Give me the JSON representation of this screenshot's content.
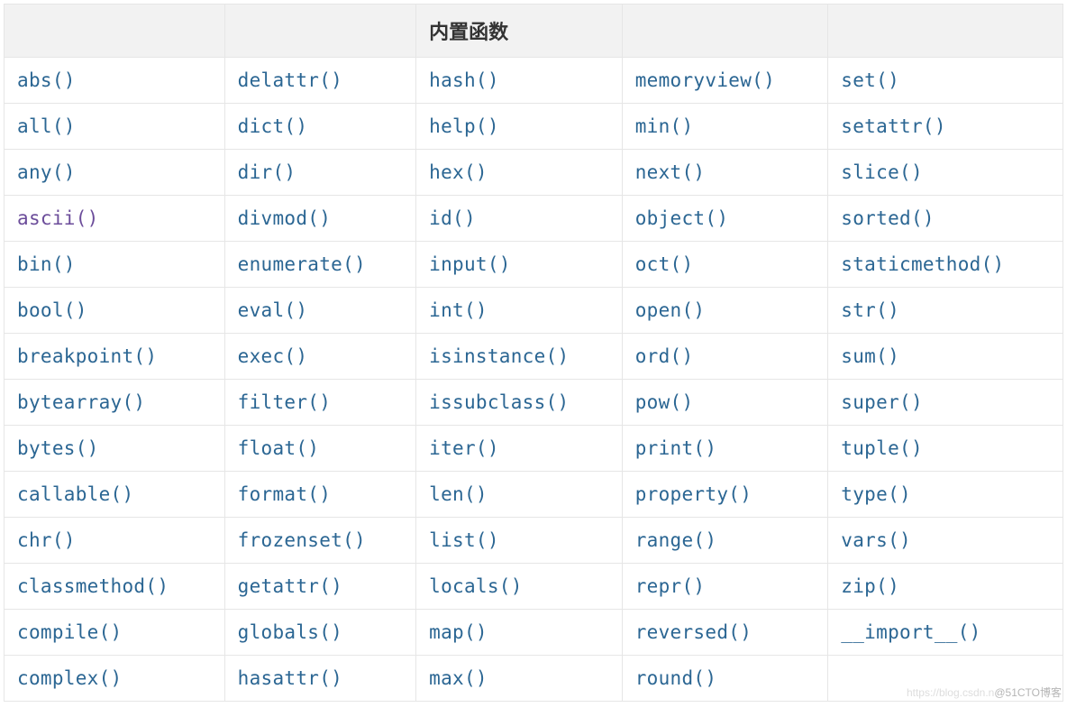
{
  "table": {
    "headers": [
      "",
      "",
      "内置函数",
      "",
      ""
    ],
    "rows": [
      [
        {
          "label": "abs()"
        },
        {
          "label": "delattr()"
        },
        {
          "label": "hash()"
        },
        {
          "label": "memoryview()"
        },
        {
          "label": "set()"
        }
      ],
      [
        {
          "label": "all()"
        },
        {
          "label": "dict()"
        },
        {
          "label": "help()"
        },
        {
          "label": "min()"
        },
        {
          "label": "setattr()"
        }
      ],
      [
        {
          "label": "any()"
        },
        {
          "label": "dir()"
        },
        {
          "label": "hex()"
        },
        {
          "label": "next()"
        },
        {
          "label": "slice()"
        }
      ],
      [
        {
          "label": "ascii()",
          "visited": true
        },
        {
          "label": "divmod()"
        },
        {
          "label": "id()"
        },
        {
          "label": "object()"
        },
        {
          "label": "sorted()"
        }
      ],
      [
        {
          "label": "bin()"
        },
        {
          "label": "enumerate()"
        },
        {
          "label": "input()"
        },
        {
          "label": "oct()"
        },
        {
          "label": "staticmethod()"
        }
      ],
      [
        {
          "label": "bool()"
        },
        {
          "label": "eval()"
        },
        {
          "label": "int()"
        },
        {
          "label": "open()"
        },
        {
          "label": "str()"
        }
      ],
      [
        {
          "label": "breakpoint()"
        },
        {
          "label": "exec()"
        },
        {
          "label": "isinstance()"
        },
        {
          "label": "ord()"
        },
        {
          "label": "sum()"
        }
      ],
      [
        {
          "label": "bytearray()"
        },
        {
          "label": "filter()"
        },
        {
          "label": "issubclass()"
        },
        {
          "label": "pow()"
        },
        {
          "label": "super()"
        }
      ],
      [
        {
          "label": "bytes()"
        },
        {
          "label": "float()"
        },
        {
          "label": "iter()"
        },
        {
          "label": "print()"
        },
        {
          "label": "tuple()"
        }
      ],
      [
        {
          "label": "callable()"
        },
        {
          "label": "format()"
        },
        {
          "label": "len()"
        },
        {
          "label": "property()"
        },
        {
          "label": "type()"
        }
      ],
      [
        {
          "label": "chr()"
        },
        {
          "label": "frozenset()"
        },
        {
          "label": "list()"
        },
        {
          "label": "range()"
        },
        {
          "label": "vars()"
        }
      ],
      [
        {
          "label": "classmethod()"
        },
        {
          "label": "getattr()"
        },
        {
          "label": "locals()"
        },
        {
          "label": "repr()"
        },
        {
          "label": "zip()"
        }
      ],
      [
        {
          "label": "compile()"
        },
        {
          "label": "globals()"
        },
        {
          "label": "map()"
        },
        {
          "label": "reversed()"
        },
        {
          "label": "__import__()"
        }
      ],
      [
        {
          "label": "complex()"
        },
        {
          "label": "hasattr()"
        },
        {
          "label": "max()"
        },
        {
          "label": "round()"
        },
        {
          "label": ""
        }
      ]
    ]
  },
  "watermark": {
    "faint": "https://blog.csdn.n",
    "text": "@51CTO博客"
  }
}
